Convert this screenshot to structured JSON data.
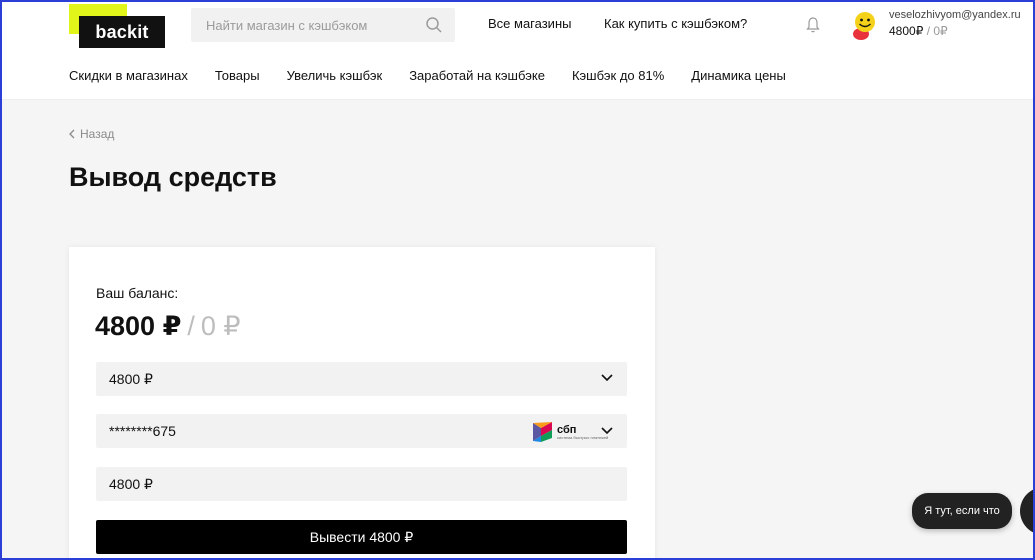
{
  "header": {
    "logo_text": "backit",
    "search_placeholder": "Найти магазин с кэшбэком",
    "links": [
      "Все магазины",
      "Как купить с кэшбэком?"
    ],
    "user_email": "veselozhivyom@yandex.ru",
    "user_balance": "4800₽",
    "user_pending": "0₽"
  },
  "nav": [
    "Скидки в магазинах",
    "Товары",
    "Увеличь кэшбэк",
    "Заработай на кэшбэке",
    "Кэшбэк до 81%",
    "Динамика цены"
  ],
  "page": {
    "back_label": "Назад",
    "title": "Вывод средств"
  },
  "card": {
    "balance_label": "Ваш баланс:",
    "balance_amount": "4800 ₽",
    "balance_pending": "0 ₽",
    "amount_select_value": "4800 ₽",
    "account_value": "********675",
    "sbp_label": "сбп",
    "sbp_sub": "система быстрых платежей",
    "amount_input_value": "4800 ₽",
    "submit_label": "Вывести 4800 ₽"
  },
  "help": {
    "bubble_text": "Я тут, если что"
  },
  "colors": {
    "brand_yellow": "#e2f51a",
    "primary_black": "#000000",
    "field_bg": "#f2f2f2",
    "frame_blue": "#2b3fd6"
  }
}
